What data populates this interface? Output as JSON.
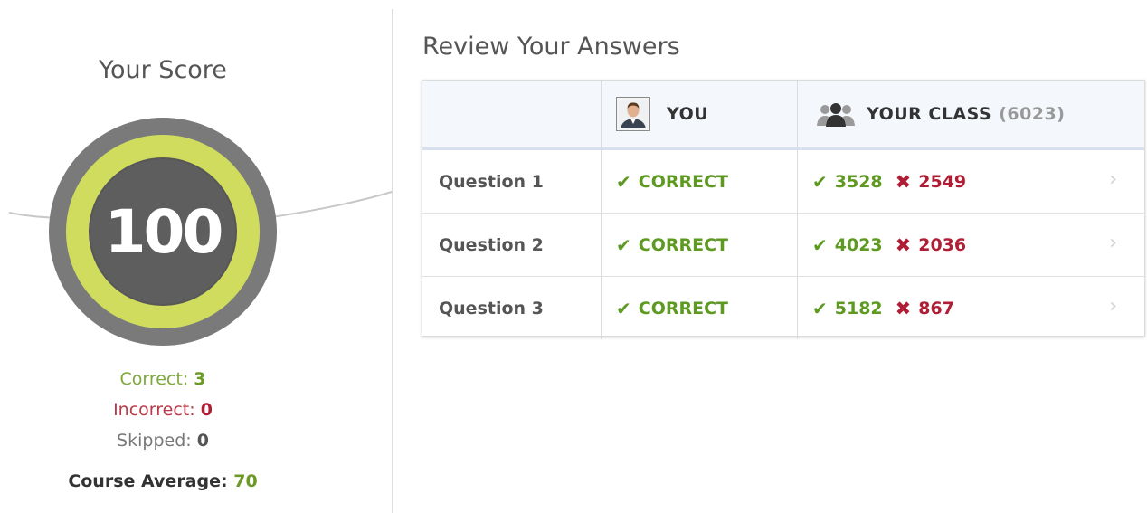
{
  "score": {
    "title": "Your Score",
    "value": "100",
    "correct_label": "Correct:",
    "correct_value": "3",
    "incorrect_label": "Incorrect:",
    "incorrect_value": "0",
    "skipped_label": "Skipped:",
    "skipped_value": "0",
    "average_label": "Course Average:",
    "average_value": "70"
  },
  "review": {
    "title": "Review Your Answers",
    "you_header": "YOU",
    "class_header": "YOUR CLASS",
    "class_count": "(6023)",
    "rows": [
      {
        "question": "Question 1",
        "result": "CORRECT",
        "class_correct": "3528",
        "class_incorrect": "2549"
      },
      {
        "question": "Question 2",
        "result": "CORRECT",
        "class_correct": "4023",
        "class_incorrect": "2036"
      },
      {
        "question": "Question 3",
        "result": "CORRECT",
        "class_correct": "5182",
        "class_incorrect": "867"
      }
    ]
  },
  "icons": {
    "avatar": "user-avatar-icon",
    "group": "group-users-icon",
    "correct": "checkmark-icon",
    "incorrect": "cross-icon",
    "row_link": "chevron-right-icon"
  },
  "colors": {
    "ring_outer": "#7a7a7a",
    "ring_progress": "#cfdc5e",
    "correct": "#5e9a21",
    "incorrect": "#b01e35"
  }
}
